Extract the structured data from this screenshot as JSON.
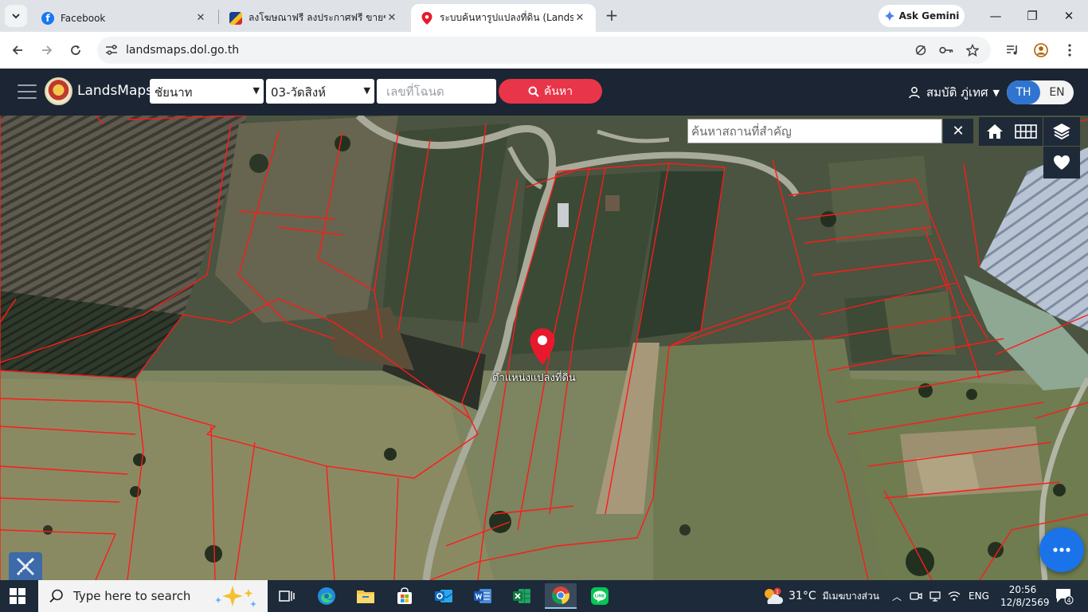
{
  "browser": {
    "tabs": [
      {
        "title": "Facebook",
        "favicon": "facebook-icon",
        "active": false
      },
      {
        "title": "ลงโฆษณาฟรี ลงประกาศฟรี ขายของอ",
        "favicon": "classifieds-icon",
        "active": false
      },
      {
        "title": "ระบบค้นหารูปแปลงที่ดิน (LandsMap",
        "favicon": "map-pin-icon",
        "active": true
      }
    ],
    "gemini_label": "Ask Gemini",
    "url": "landsmaps.dol.go.th"
  },
  "app": {
    "brand": "LandsMaps",
    "province": "ชัยนาท",
    "district": "03-วัดสิงห์",
    "deed_placeholder": "เลขที่โฉนด",
    "search_label": "ค้นหา",
    "user_name": "สมบัติ ภู่เทศ",
    "lang_th": "TH",
    "lang_en": "EN"
  },
  "map": {
    "place_search_placeholder": "ค้นหาสถานที่สำคัญ",
    "marker_label": "ตำแหน่งแปลงที่ดิน",
    "parcel_line_color": "#ff1a1a",
    "marker_color": "#e8192c"
  },
  "taskbar": {
    "search_placeholder": "Type here to search",
    "weather_temp": "31°C",
    "weather_text": "มีเมฆบางส่วน",
    "language": "ENG",
    "time": "20:56",
    "date": "12/8/2569",
    "notification_count": "4",
    "weather_alert": "1"
  }
}
